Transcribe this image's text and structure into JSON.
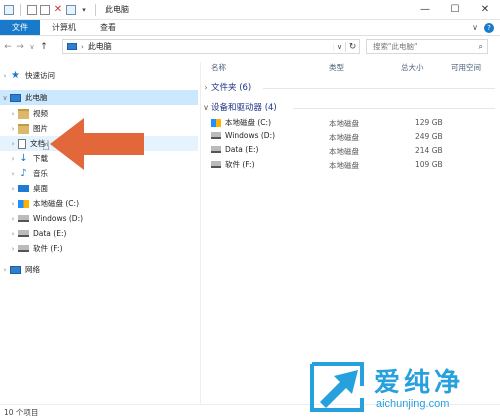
{
  "window": {
    "title": "此电脑",
    "controls": {
      "minimize": "—",
      "maximize": "☐",
      "close": "✕"
    }
  },
  "ribbon": {
    "tabs": [
      "文件",
      "计算机",
      "查看"
    ],
    "expand_icon": "chevron-down-icon",
    "help_icon": "help-icon"
  },
  "navigation": {
    "back": "←",
    "forward": "→",
    "recent": "∨",
    "up": "↑",
    "address_crumb": "此电脑",
    "refresh": "↻",
    "search_placeholder": "搜索\"此电脑\""
  },
  "sidebar": {
    "items": [
      {
        "label": "快速访问",
        "icon": "star-icon"
      },
      {
        "label": "此电脑",
        "icon": "computer-icon"
      },
      {
        "label": "视频",
        "icon": "folder-icon"
      },
      {
        "label": "图片",
        "icon": "folder-icon"
      },
      {
        "label": "文档",
        "icon": "document-icon"
      },
      {
        "label": "下载",
        "icon": "download-icon"
      },
      {
        "label": "音乐",
        "icon": "music-icon"
      },
      {
        "label": "桌面",
        "icon": "desktop-icon"
      },
      {
        "label": "本地磁盘 (C:)",
        "icon": "drive-icon"
      },
      {
        "label": "Windows (D:)",
        "icon": "drive-icon"
      },
      {
        "label": "Data (E:)",
        "icon": "drive-icon"
      },
      {
        "label": "软件 (F:)",
        "icon": "drive-icon"
      },
      {
        "label": "网络",
        "icon": "network-icon"
      }
    ]
  },
  "content": {
    "columns": {
      "name": "名称",
      "type": "类型",
      "total_size": "总大小",
      "free_space": "可用空间"
    },
    "groups": [
      {
        "label": "文件夹 (6)",
        "expanded": false
      },
      {
        "label": "设备和驱动器 (4)",
        "expanded": true
      }
    ],
    "drives": [
      {
        "name": "本地磁盘 (C:)",
        "type": "本地磁盘",
        "total": "129 GB"
      },
      {
        "name": "Windows (D:)",
        "type": "本地磁盘",
        "total": "249 GB"
      },
      {
        "name": "Data (E:)",
        "type": "本地磁盘",
        "total": "214 GB"
      },
      {
        "name": "软件 (F:)",
        "type": "本地磁盘",
        "total": "109 GB"
      }
    ]
  },
  "status": {
    "item_count": "10 个项目"
  },
  "annotation": {
    "arrow_color": "#e2683c"
  },
  "watermark": {
    "title": "爱纯净",
    "url": "aichunjing.com",
    "color": "#27a0de"
  }
}
